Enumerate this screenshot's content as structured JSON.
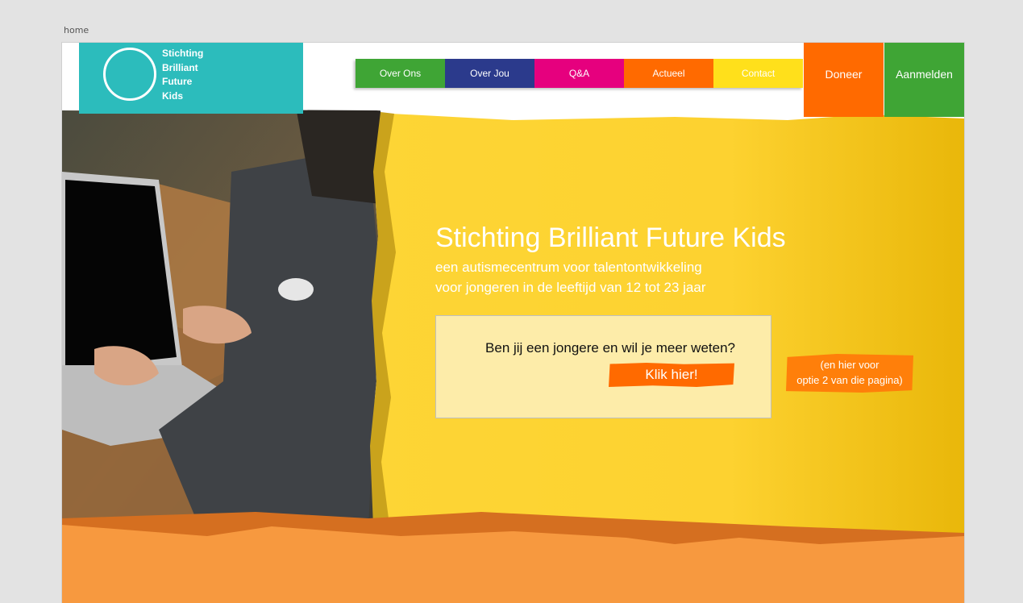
{
  "page_label": "home",
  "logo": {
    "lines": [
      "Stichting",
      "Brilliant",
      "Future",
      "Kids"
    ]
  },
  "nav": {
    "items": [
      {
        "label": "Over Ons",
        "color": "#3fa535"
      },
      {
        "label": "Over Jou",
        "color": "#2b3a8c"
      },
      {
        "label": "Q&A",
        "color": "#e6007e"
      },
      {
        "label": "Actueel",
        "color": "#ff6a00"
      },
      {
        "label": "Contact",
        "color": "#ffe01b"
      }
    ],
    "donate_label": "Doneer",
    "signup_label": "Aanmelden"
  },
  "hero": {
    "title": "Stichting Brilliant Future Kids",
    "subtitle_line1": "een autismecentrum voor talentontwikkeling",
    "subtitle_line2": "voor jongeren in de leeftijd van 12 tot 23 jaar",
    "question": "Ben jij een jongere en wil je meer weten?",
    "cta_label": "Klik hier!",
    "option2_line1": "(en hier voor",
    "option2_line2": "optie 2 van die pagina)"
  },
  "colors": {
    "teal": "#2cbcbc",
    "yellow": "#fdd535",
    "orange": "#f7993f",
    "cta_orange": "#ff6a00",
    "green": "#3fa535"
  }
}
